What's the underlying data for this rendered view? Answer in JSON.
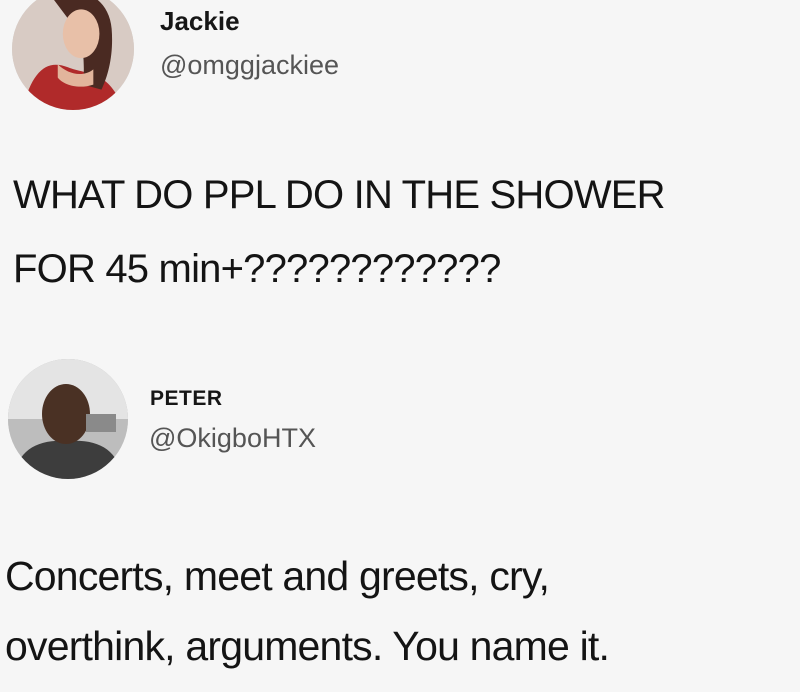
{
  "tweets": [
    {
      "name": "Jackie",
      "handle": "@omggjackiee",
      "lines": [
        "WHAT DO PPL DO IN THE SHOWER",
        "FOR 45 min+????????????"
      ]
    },
    {
      "name": "PETER",
      "handle": "@OkigboHTX",
      "lines": [
        "Concerts, meet and greets, cry,",
        "overthink, arguments. You name it."
      ]
    }
  ],
  "colors": {
    "background": "#f6f6f6",
    "text": "#161616",
    "handle": "#555555"
  }
}
